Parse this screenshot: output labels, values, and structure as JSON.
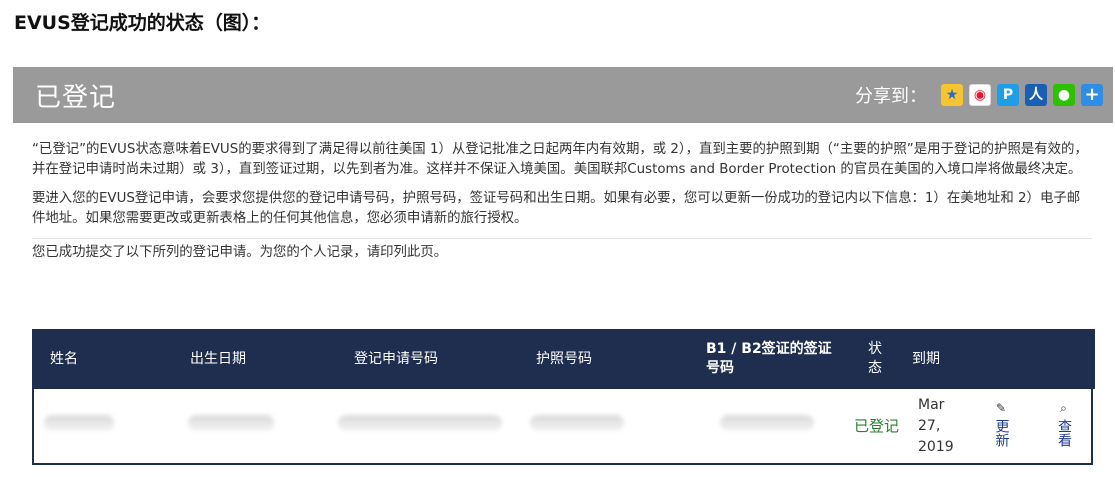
{
  "doc_title": "EVUS登记成功的状态（图）：",
  "header": {
    "title": "已登记",
    "share_label": "分享到：",
    "share_icons": [
      "qzone-icon",
      "weibo-icon",
      "tencent-weibo-icon",
      "renren-icon",
      "wechat-icon",
      "more-share-icon"
    ]
  },
  "content": {
    "para1": "“已登记”的EVUS状态意味着EVUS的要求得到了满足得以前往美国 1）从登记批准之日起两年内有效期，或 2），直到主要的护照到期（“主要的护照”是用于登记的护照是有效的，并在登记申请时尚未过期）或 3），直到签证过期，以先到者为准。这样并不保证入境美国。美国联邦Customs and Border Protection 的官员在美国的入境口岸将做最终决定。",
    "para2": "要进入您的EVUS登记申请，会要求您提供您的登记申请号码，护照号码，签证号码和出生日期。如果有必要，您可以更新一份成功的登记内以下信息：1）在美地址和 2）电子邮件地址。如果您需要更改或更新表格上的任何其他信息，您必须申请新的旅行授权。",
    "para3": "您已成功提交了以下所列的登记申请。为您的个人记录，请印列此页。"
  },
  "table": {
    "headers": {
      "name": "姓名",
      "dob": "出生日期",
      "app_no": "登记申请号码",
      "passport": "护照号码",
      "visa": "B1 / B2签证的签证号码",
      "status": "状态",
      "expiry": "到期"
    },
    "row": {
      "status": "已登记",
      "expiry": "Mar 27, 2019",
      "update_label": "更新",
      "view_label": "查看"
    }
  },
  "colors": {
    "header_bar": "#9a9a9a",
    "table_header": "#1f2d4e",
    "status_green": "#2e7d32",
    "action_blue": "#1f3c88"
  }
}
